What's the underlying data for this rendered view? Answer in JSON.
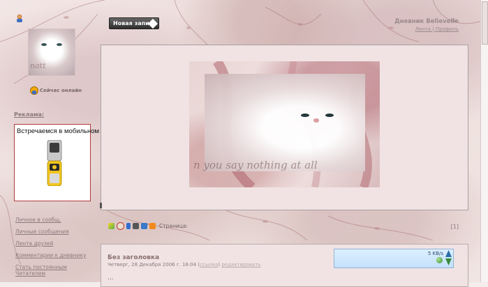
{
  "page": {
    "new_post_label": "Новая запись",
    "diary_title": "Дневник Believelle",
    "diary_subtitle": "Лента | Профиль"
  },
  "sidebar": {
    "online_label": "Сейчас онлайн",
    "ads_label": "Реклама:",
    "ad_text": "Встречаемся в мобильном",
    "links": [
      "Личное в сообщ.",
      "Личные сообщения",
      "Лента друзей",
      "Комментарии к дневнику",
      "Стать постоянным",
      "Читателем"
    ]
  },
  "banner": {
    "script_text": "n you say nothing at all"
  },
  "avatar": {
    "watermark": "natt"
  },
  "share": {
    "label": "Страница:",
    "pager": "[1]"
  },
  "post": {
    "title": "Без заголовка",
    "date": "Четверг, 28 Декабря 2006 г. 16:04",
    "link1": "ссылка",
    "link2": "редактировать",
    "body": "..."
  },
  "status": {
    "speed": "5 KB/s"
  },
  "colors": {
    "panel_bg": "#f1e3e4",
    "ad_border": "#b13a3a",
    "button_bg": "#3a3a3a"
  }
}
